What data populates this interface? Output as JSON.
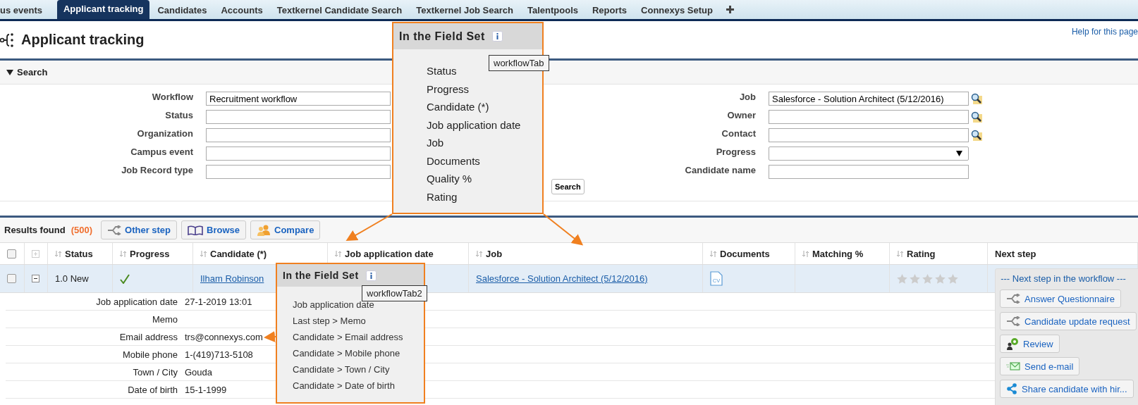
{
  "nav_tabs": [
    {
      "label": "us events",
      "selected": false
    },
    {
      "label": "Applicant tracking",
      "selected": true
    },
    {
      "label": "Candidates",
      "selected": false
    },
    {
      "label": "Accounts",
      "selected": false
    },
    {
      "label": "Textkernel Candidate Search",
      "selected": false
    },
    {
      "label": "Textkernel Job Search",
      "selected": false
    },
    {
      "label": "Talentpools",
      "selected": false
    },
    {
      "label": "Reports",
      "selected": false
    },
    {
      "label": "Connexys Setup",
      "selected": false
    }
  ],
  "page": {
    "title": "Applicant tracking",
    "help_link": "Help for this page"
  },
  "search": {
    "title": "Search",
    "expanded": true,
    "left_fields": [
      {
        "label": "Workflow",
        "value": "Recruitment workflow"
      },
      {
        "label": "Status"
      },
      {
        "label": "Organization"
      },
      {
        "label": "Campus event"
      },
      {
        "label": "Job Record type"
      }
    ],
    "right_fields": [
      {
        "label": "Job",
        "value": "Salesforce - Solution Architect (5/12/2016)",
        "kind": "lookup"
      },
      {
        "label": "Owner",
        "kind": "lookup"
      },
      {
        "label": "Contact",
        "kind": "lookup"
      },
      {
        "label": "Progress",
        "kind": "select"
      },
      {
        "label": "Candidate name",
        "kind": "text"
      }
    ],
    "button": "Search"
  },
  "results": {
    "label": "Results found",
    "count": "(500)",
    "buttons": [
      {
        "label": "Other step",
        "kind": "step"
      },
      {
        "label": "Browse",
        "kind": "browse"
      },
      {
        "label": "Compare",
        "kind": "compare"
      }
    ]
  },
  "table": {
    "select_all_checked": false,
    "columns": [
      {
        "label": "Status",
        "sortable": true
      },
      {
        "label": "Progress",
        "sortable": true
      },
      {
        "label": "Candidate (*)",
        "sortable": true
      },
      {
        "label": "Job application date",
        "sortable": true
      },
      {
        "label": "Job",
        "sortable": true
      },
      {
        "label": "Documents",
        "sortable": true
      },
      {
        "label": "Matching %",
        "sortable": true
      },
      {
        "label": "Rating",
        "sortable": true
      },
      {
        "label": "Next step",
        "sortable": false
      }
    ],
    "rows": [
      {
        "checked": false,
        "expanded": true,
        "status": "1.0 New",
        "progress_done": true,
        "candidate": "Ilham Robinson",
        "job": "Salesforce - Solution Architect (5/12/2016)",
        "document": "CV",
        "stars": 0,
        "details": [
          {
            "label": "Job application date",
            "value": "27-1-2019 13:01"
          },
          {
            "label": "Memo"
          },
          {
            "label": "Email address",
            "value": "trs@connexys.com"
          },
          {
            "label": "Mobile phone",
            "value": "1-(419)713-5108"
          },
          {
            "label": "Town / City",
            "value": "Gouda"
          },
          {
            "label": "Date of birth",
            "value": "15-1-1999"
          }
        ]
      }
    ]
  },
  "next_step": {
    "title": "--- Next step in the workflow ---",
    "actions": [
      {
        "label": "Answer Questionnaire",
        "kind": "step"
      },
      {
        "label": "Candidate update request",
        "kind": "step"
      },
      {
        "label": "Review",
        "kind": "review"
      },
      {
        "label": "Send e-mail",
        "kind": "email"
      },
      {
        "label": "Share candidate with hir...",
        "kind": "share"
      }
    ]
  },
  "callouts": [
    {
      "title": "In the Field Set",
      "tooltip": "workflowTab",
      "fields": [
        "Status",
        "Progress",
        "Candidate (*)",
        "Job application date",
        "Job",
        "Documents",
        "Quality %",
        "Rating"
      ]
    },
    {
      "title": "In the Field Set",
      "tooltip": "workflowTab2",
      "fields": [
        "Job application date",
        "Last step > Memo",
        "Candidate > Email address",
        "Candidate > Mobile phone",
        "Candidate > Town / City",
        "Candidate > Date of birth"
      ]
    }
  ]
}
